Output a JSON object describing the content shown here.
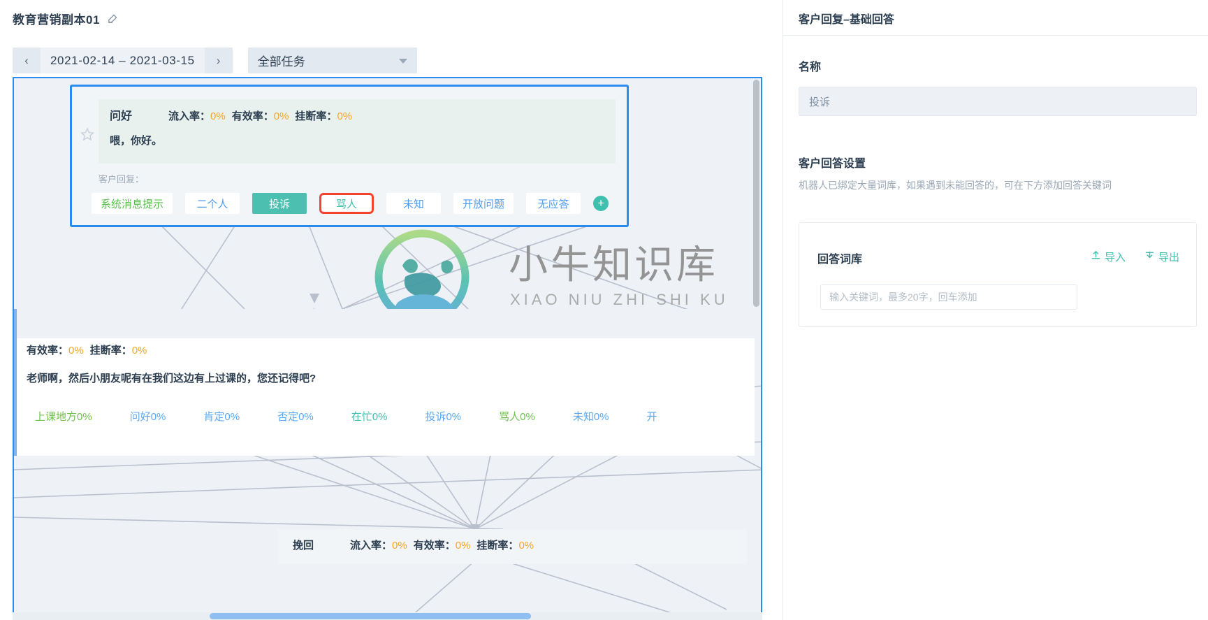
{
  "header": {
    "title": "教育营销副本01",
    "edit_icon": "pencil-icon"
  },
  "toolbar": {
    "prev_label": "‹",
    "next_label": "›",
    "date_range": "2021-02-14 – 2021-03-15",
    "task_filter": "全部任务"
  },
  "canvas": {
    "greeting_node": {
      "name": "问好",
      "metrics": {
        "inflow_label": "流入率：",
        "inflow_value": "0%",
        "valid_label": "有效率：",
        "valid_value": "0%",
        "hangup_label": "挂断率：",
        "hangup_value": "0%"
      },
      "script": "喂，你好。",
      "reply_label": "客户回复：",
      "tags": [
        {
          "label": "系统消息提示",
          "style": "green"
        },
        {
          "label": "二个人",
          "style": "blue"
        },
        {
          "label": "投诉",
          "style": "active"
        },
        {
          "label": "骂人",
          "style": "highlight"
        },
        {
          "label": "未知",
          "style": "blue"
        },
        {
          "label": "开放问题",
          "style": "blue"
        },
        {
          "label": "无应答",
          "style": "blue"
        }
      ],
      "add_tag_label": "+"
    },
    "second_node": {
      "metrics": {
        "valid_label": "有效率：",
        "valid_value": "0%",
        "hangup_label": "挂断率：",
        "hangup_value": "0%"
      },
      "script": "老师啊，然后小朋友呢有在我们这边有上过课的，您还记得吧?"
    },
    "percent_tags": [
      {
        "label": "上课地方0%",
        "style": "green"
      },
      {
        "label": "问好0%",
        "style": "blue"
      },
      {
        "label": "肯定0%",
        "style": "blue"
      },
      {
        "label": "否定0%",
        "style": "blue"
      },
      {
        "label": "在忙0%",
        "style": "teal"
      },
      {
        "label": "投诉0%",
        "style": "blue"
      },
      {
        "label": "骂人0%",
        "style": "green"
      },
      {
        "label": "未知0%",
        "style": "blue"
      },
      {
        "label": "开",
        "style": "blue"
      }
    ],
    "third_node": {
      "name": "挽回",
      "metrics": {
        "inflow_label": "流入率：",
        "inflow_value": "0%",
        "valid_label": "有效率：",
        "valid_value": "0%",
        "hangup_label": "挂断率：",
        "hangup_value": "0%"
      }
    },
    "watermark": {
      "text_cn": "小牛知识库",
      "text_en": "XIAO NIU ZHI SHI KU"
    }
  },
  "right_panel": {
    "title": "客户回复–基础回答",
    "name_label": "名称",
    "name_value": "投诉",
    "answer_settings_label": "客户回答设置",
    "answer_settings_desc": "机器人已绑定大量词库，如果遇到未能回答的，可在下方添加回答关键词",
    "library": {
      "title": "回答词库",
      "import_label": "导入",
      "export_label": "导出",
      "keyword_placeholder": "输入关键词，最多20字，回车添加"
    }
  },
  "colors": {
    "accent_blue": "#2b8cf0",
    "teal": "#3fc0ae",
    "green": "#6cc24a",
    "orange": "#f5a623",
    "highlight_red": "#f4432e"
  }
}
